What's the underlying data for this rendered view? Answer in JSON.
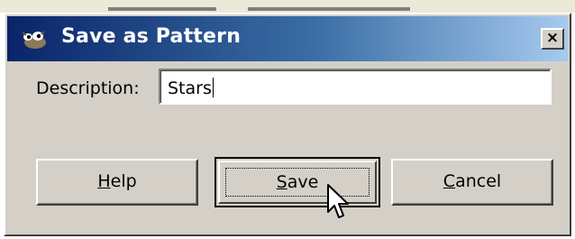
{
  "window": {
    "title": "Save as Pattern",
    "app_icon": "gimp-wilber-icon",
    "close_label": "×"
  },
  "form": {
    "description_label": "Description:",
    "description_value": "Stars"
  },
  "buttons": {
    "help": {
      "mnemonic": "H",
      "rest": "elp"
    },
    "save": {
      "mnemonic": "S",
      "rest": "ave",
      "default": true
    },
    "cancel": {
      "mnemonic": "C",
      "rest": "ancel"
    }
  },
  "pointer": {
    "icon": "arrow-cursor-icon"
  },
  "colors": {
    "titlebar_start": "#0a246a",
    "titlebar_end": "#a6caf0",
    "dialog_face": "#d4d0c8"
  }
}
